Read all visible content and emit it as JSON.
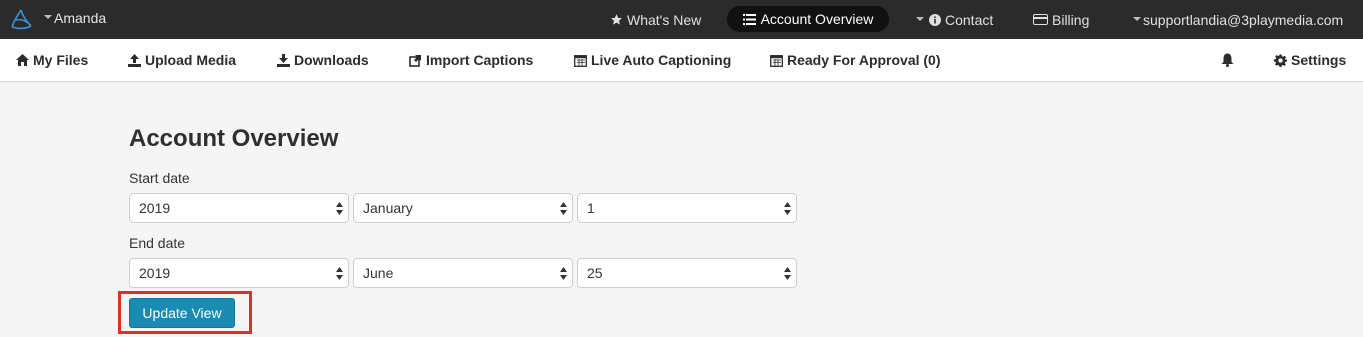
{
  "topbar": {
    "user_name": "Amanda",
    "whats_new": "What's New",
    "account_overview": "Account Overview",
    "contact": "Contact",
    "billing": "Billing",
    "email": "supportlandia@3playmedia.com"
  },
  "subnav": {
    "my_files": "My Files",
    "upload_media": "Upload Media",
    "downloads": "Downloads",
    "import_captions": "Import Captions",
    "live_auto_captioning": "Live Auto Captioning",
    "ready_for_approval": "Ready For Approval (0)",
    "settings": "Settings"
  },
  "page": {
    "title": "Account Overview",
    "start_date_label": "Start date",
    "end_date_label": "End date",
    "start": {
      "year": "2019",
      "month": "January",
      "day": "1"
    },
    "end": {
      "year": "2019",
      "month": "June",
      "day": "25"
    },
    "update_button": "Update View"
  },
  "colors": {
    "topbar_bg": "#2b2b2b",
    "button_bg": "#1a8bb3",
    "highlight": "#e0301e"
  }
}
